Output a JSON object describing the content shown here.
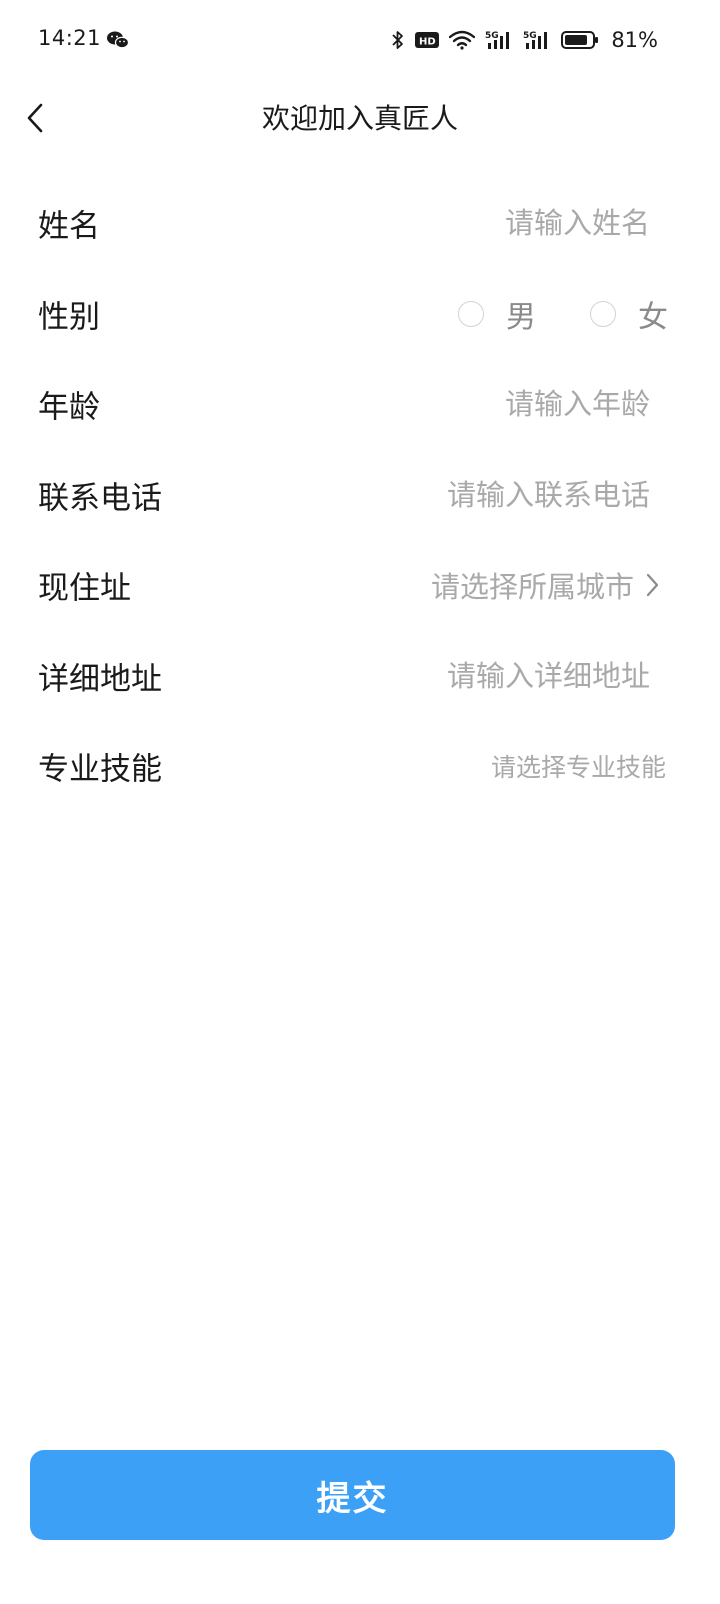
{
  "status_bar": {
    "time": "14:21",
    "battery_percent": "81%",
    "icons": [
      "wechat-icon",
      "bluetooth-icon",
      "hd-icon",
      "wifi-icon",
      "5g-signal-icon",
      "5g-signal-icon",
      "battery-icon"
    ]
  },
  "nav": {
    "title": "欢迎加入真匠人",
    "back_icon": "chevron-left-icon"
  },
  "form": {
    "name": {
      "label": "姓名",
      "placeholder": "请输入姓名",
      "value": ""
    },
    "gender": {
      "label": "性别",
      "options": [
        {
          "label": "男",
          "selected": false
        },
        {
          "label": "女",
          "selected": false
        }
      ]
    },
    "age": {
      "label": "年龄",
      "placeholder": "请输入年龄",
      "value": ""
    },
    "phone": {
      "label": "联系电话",
      "placeholder": "请输入联系电话",
      "value": ""
    },
    "residence": {
      "label": "现住址",
      "placeholder": "请选择所属城市",
      "icon": "chevron-right-icon"
    },
    "address": {
      "label": "详细地址",
      "placeholder": "请输入详细地址",
      "value": ""
    },
    "skills": {
      "label": "专业技能",
      "placeholder": "请选择专业技能"
    }
  },
  "submit": {
    "label": "提交"
  },
  "colors": {
    "accent": "#3da0f7",
    "placeholder": "#a9a9a9",
    "text": "#1a1a1a"
  }
}
